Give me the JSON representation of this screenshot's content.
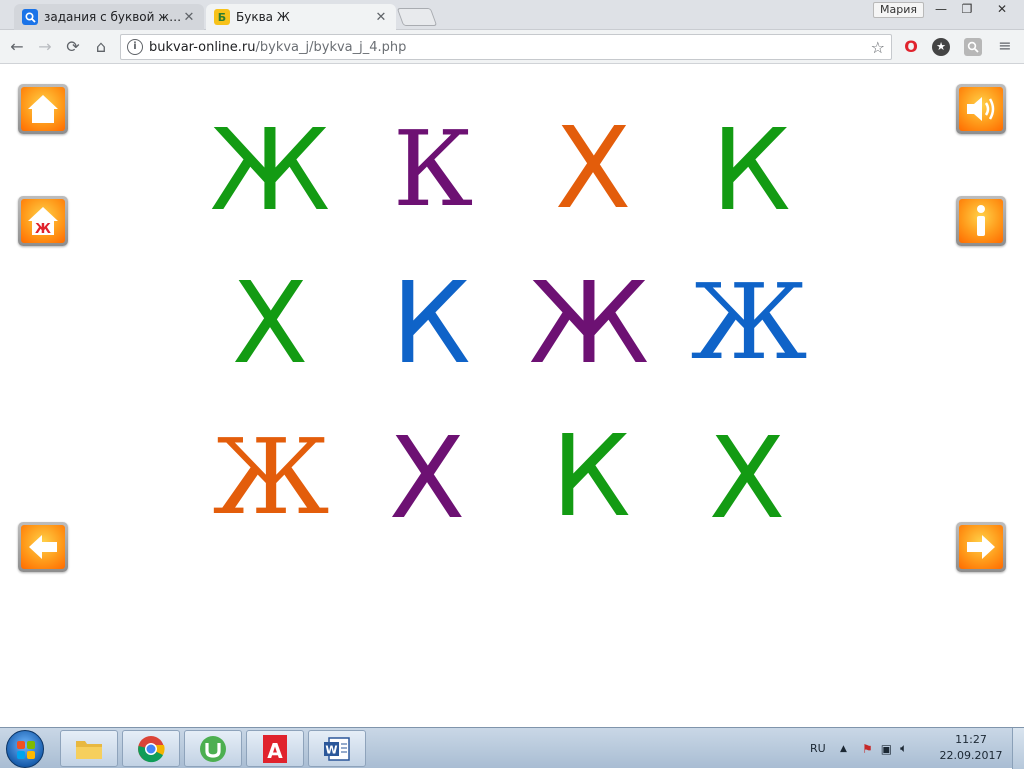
{
  "browser": {
    "tabs": [
      {
        "title": "задания с буквой ж Ж -",
        "favicon": "search-icon",
        "active": false
      },
      {
        "title": "Буква Ж",
        "favicon": "bukva-favicon",
        "favicon_letter": "Б",
        "active": true
      }
    ],
    "user": "Мария",
    "url_host": "bukvar-online.ru",
    "url_path": "/bykva_j/bykva_j_4.php",
    "info_glyph": "i"
  },
  "page": {
    "badge_letter": "Ж",
    "letters": [
      {
        "char": "Ж",
        "color": "#139b13"
      },
      {
        "char": "К",
        "color": "#6d1173"
      },
      {
        "char": "Х",
        "color": "#e35d0b"
      },
      {
        "char": "К",
        "color": "#139b13"
      },
      {
        "char": "Х",
        "color": "#139b13"
      },
      {
        "char": "К",
        "color": "#0f63c8"
      },
      {
        "char": "Ж",
        "color": "#6d1173"
      },
      {
        "char": "Ж",
        "color": "#0f63c8"
      },
      {
        "char": "Ж",
        "color": "#e35d0b"
      },
      {
        "char": "Х",
        "color": "#6d1173"
      },
      {
        "char": "К",
        "color": "#139b13"
      },
      {
        "char": "Х",
        "color": "#139b13"
      }
    ]
  },
  "taskbar": {
    "lang": "RU",
    "time": "11:27",
    "date": "22.09.2017",
    "abbyy_letter": "A",
    "word_letter": "W"
  },
  "colors": {
    "green": "#139b13",
    "purple": "#6d1173",
    "orange": "#e35d0b",
    "blue": "#0f63c8",
    "button_orange": "#ff8a10"
  }
}
